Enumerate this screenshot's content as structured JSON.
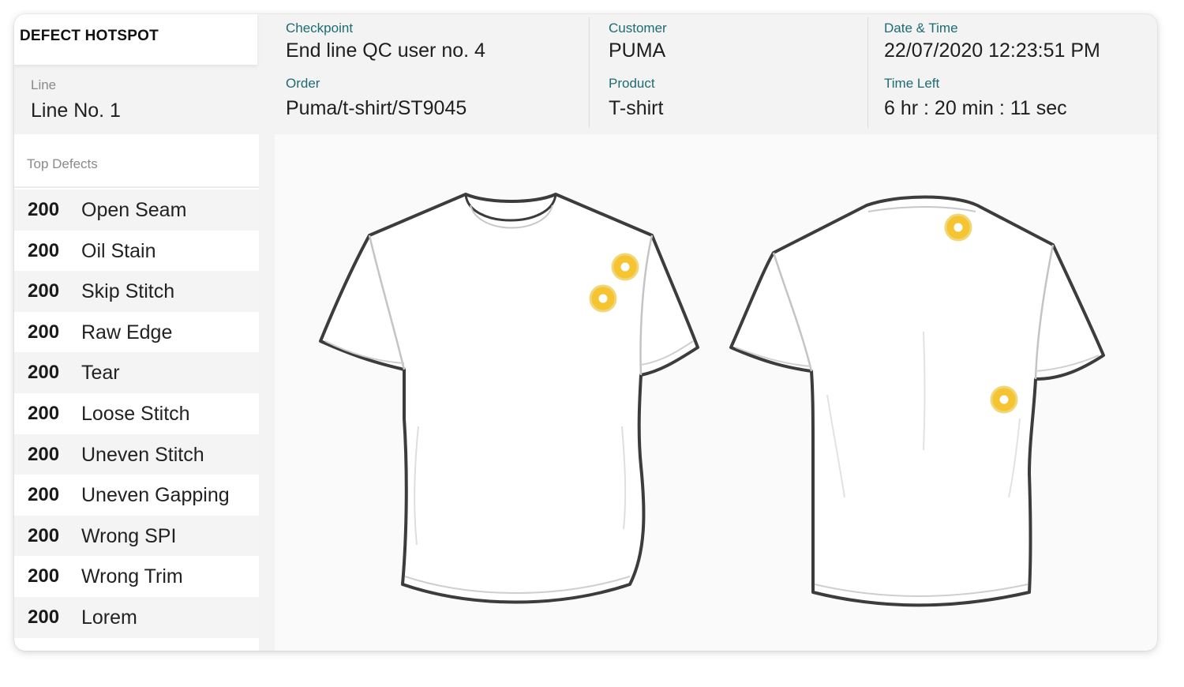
{
  "header": {
    "title": "DEFECT HOTSPOT",
    "line": {
      "label": "Line",
      "value": "Line No. 1"
    },
    "checkpoint": {
      "label": "Checkpoint",
      "value": "End line QC user no. 4"
    },
    "order": {
      "label": "Order",
      "value": "Puma/t-shirt/ST9045"
    },
    "customer": {
      "label": "Customer",
      "value": "PUMA"
    },
    "product": {
      "label": "Product",
      "value": "T-shirt"
    },
    "datetime": {
      "label": "Date & Time",
      "value": "22/07/2020 12:23:51 PM"
    },
    "time_left": {
      "label": "Time Left",
      "value": "6 hr : 20 min : 11 sec"
    }
  },
  "sidebar": {
    "title": "Top Defects",
    "defects": [
      {
        "count": "200",
        "name": "Open Seam"
      },
      {
        "count": "200",
        "name": "Oil Stain"
      },
      {
        "count": "200",
        "name": "Skip Stitch"
      },
      {
        "count": "200",
        "name": "Raw Edge"
      },
      {
        "count": "200",
        "name": "Tear"
      },
      {
        "count": "200",
        "name": "Loose Stitch"
      },
      {
        "count": "200",
        "name": "Uneven Stitch"
      },
      {
        "count": "200",
        "name": "Uneven Gapping"
      },
      {
        "count": "200",
        "name": "Wrong SPI"
      },
      {
        "count": "200",
        "name": "Wrong Trim"
      },
      {
        "count": "200",
        "name": "Lorem"
      }
    ]
  },
  "garment": {
    "views": [
      "front",
      "back"
    ],
    "hotspot_color": "#f5c430",
    "hotspot_count": 4
  },
  "colors": {
    "label_accent": "#1d6b73",
    "hotspot": "#f5c430"
  }
}
